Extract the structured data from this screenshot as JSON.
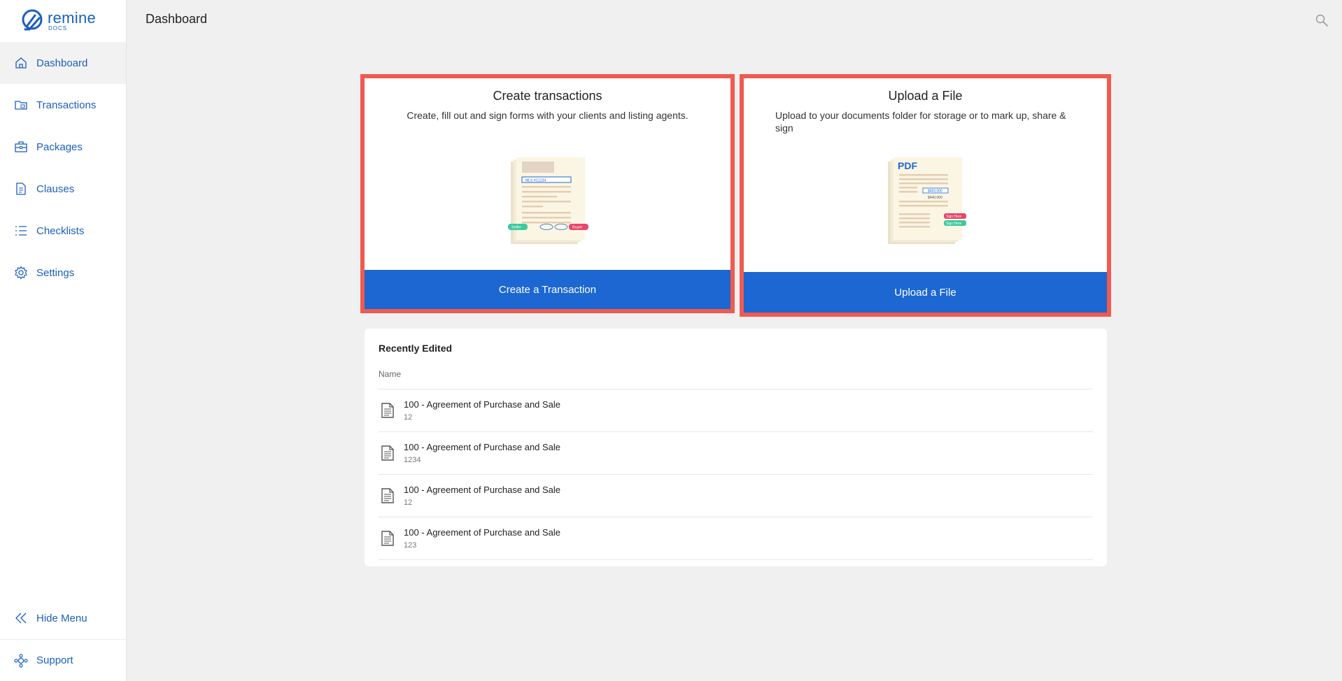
{
  "brand": {
    "name": "remine",
    "sub": "DOCS",
    "color": "#1c5fbf"
  },
  "sidebar": {
    "items": [
      {
        "label": "Dashboard",
        "icon": "home-icon",
        "active": true
      },
      {
        "label": "Transactions",
        "icon": "folder-icon"
      },
      {
        "label": "Packages",
        "icon": "briefcase-icon"
      },
      {
        "label": "Clauses",
        "icon": "document-icon"
      },
      {
        "label": "Checklists",
        "icon": "list-icon"
      },
      {
        "label": "Settings",
        "icon": "gear-icon"
      }
    ],
    "hide_menu": "Hide Menu",
    "support": "Support"
  },
  "header": {
    "title": "Dashboard",
    "search_icon": "search-icon"
  },
  "cards": [
    {
      "title": "Create transactions",
      "description": "Create, fill out and sign forms with your clients and listing agents.",
      "button": "Create a Transaction",
      "illustration": {
        "field": "MLS #C1234",
        "left_tag": "Seller",
        "right_tag": "Buyer"
      }
    },
    {
      "title": "Upload a File",
      "description": "Upload to your documents folder for storage or to mark up, share & sign",
      "button": "Upload a File",
      "illustration": {
        "label": "PDF",
        "price1": "$450,000",
        "price2": "$440,000",
        "tag1": "Sign Here",
        "tag2": "Sign Here"
      }
    }
  ],
  "recent": {
    "title": "Recently Edited",
    "column": "Name",
    "rows": [
      {
        "name": "100 - Agreement of Purchase and Sale",
        "sub": "12"
      },
      {
        "name": "100 - Agreement of Purchase and Sale",
        "sub": "1234"
      },
      {
        "name": "100 - Agreement of Purchase and Sale",
        "sub": "12"
      },
      {
        "name": "100 - Agreement of Purchase and Sale",
        "sub": "123"
      }
    ]
  },
  "colors": {
    "accent": "#1c67d2",
    "highlight": "#f05a4f",
    "seller": "#3cc9a0",
    "buyer": "#e8456a"
  }
}
